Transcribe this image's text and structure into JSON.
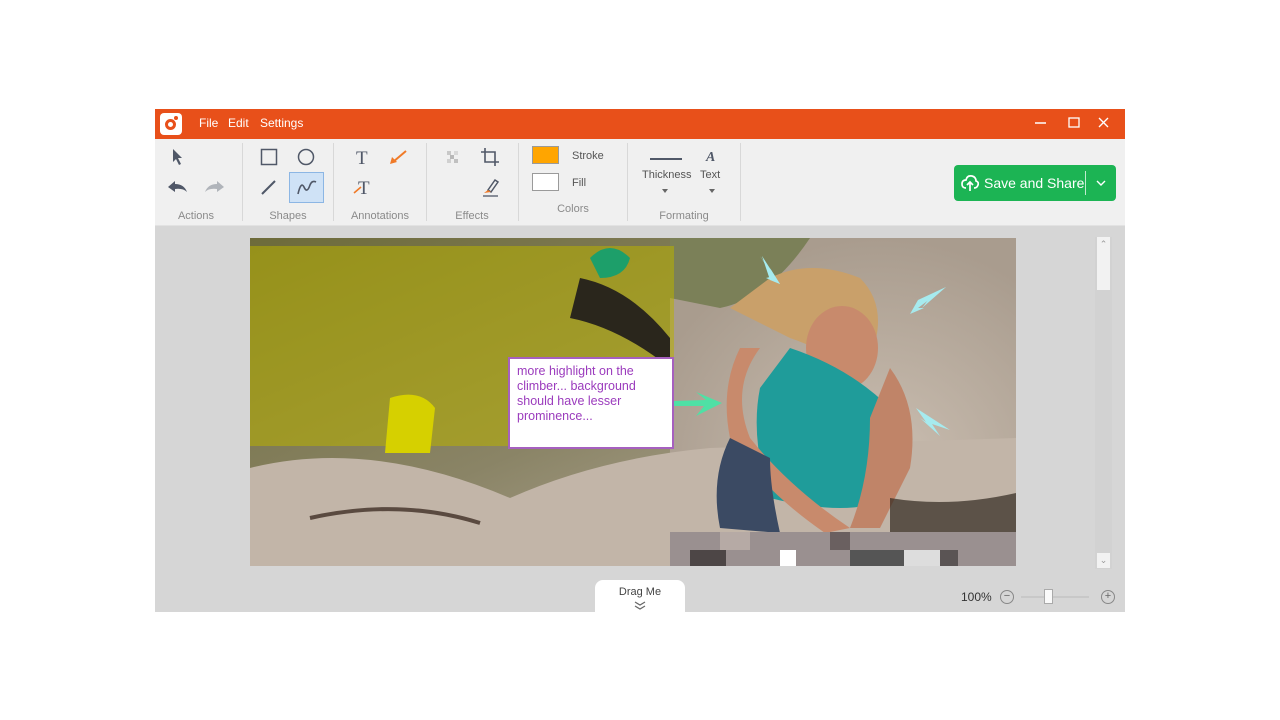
{
  "titlebar": {
    "menu": [
      "File",
      "Edit",
      "Settings"
    ],
    "controls": [
      "minimize",
      "maximize",
      "close"
    ],
    "color": "#e8501a"
  },
  "toolbar": {
    "groups": {
      "actions": "Actions",
      "shapes": "Shapes",
      "annotations": "Annotations",
      "effects": "Effects",
      "colors": "Colors",
      "formatting": "Formating"
    },
    "colors": {
      "stroke_label": "Stroke",
      "fill_label": "Fill",
      "stroke_color": "#ffa500",
      "fill_color": "#ffffff"
    },
    "formatting": {
      "thickness_label": "Thickness",
      "text_label": "Text"
    },
    "active_tool": "freehand",
    "save_button": {
      "label": "Save and Share",
      "color": "#1cb454"
    }
  },
  "canvas": {
    "note_text": "more highlight on the climber... background should have lesser prominence...",
    "note_border_color": "#a660bf",
    "note_text_color": "#9b3bbd",
    "arrow_colors": [
      "#a6ebef",
      "#4fe0a5"
    ]
  },
  "footer": {
    "drag_label": "Drag Me",
    "zoom_level": "100%",
    "zoom_slider_fraction": 0.4
  }
}
